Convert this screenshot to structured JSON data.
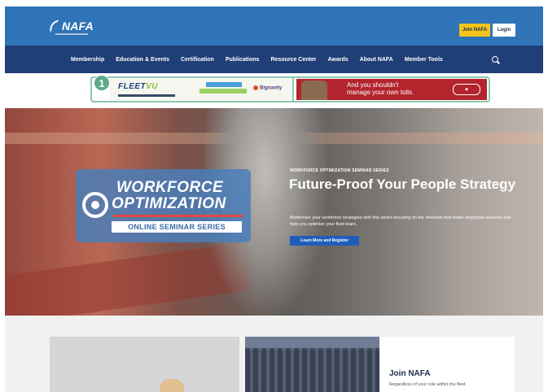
{
  "header": {
    "logo_text": "NAFA",
    "join_label": "Join NAFA",
    "login_label": "Login"
  },
  "nav": {
    "items": [
      {
        "label": "Membership"
      },
      {
        "label": "Education & Events"
      },
      {
        "label": "Certification"
      },
      {
        "label": "Publications"
      },
      {
        "label": "Resource Center"
      },
      {
        "label": "Awards"
      },
      {
        "label": "About NAFA"
      },
      {
        "label": "Member Tools"
      }
    ]
  },
  "ads": {
    "badge_number": "1",
    "ad1": {
      "logo_prefix": "FLEET",
      "logo_suffix": "VU",
      "brand": "Bignanity"
    },
    "ad2": {
      "text_line1": "And you shouldn't",
      "text_line2": "manage your own tolls."
    }
  },
  "hero": {
    "seminar_title_line1": "WORKFORCE",
    "seminar_title_line2": "OPTIMIZATION",
    "seminar_subtitle": "ONLINE SEMINAR SERIES",
    "eyebrow": "WORKFORCE OPTIMIZATION SEMINAR SERIES",
    "headline": "Future-Proof Your People Strategy",
    "body": "Modernize your workforce strategies with this series focusing on the methods that foster employee success and help you optimize your fleet team.",
    "cta_label": "Learn More and Register"
  },
  "below": {
    "join_title": "Join NAFA",
    "join_text": "Regardless of your role within the fleet"
  },
  "colors": {
    "header_blue": "#2f74b7",
    "nav_navy": "#1f3f76",
    "join_yellow": "#f2c41d",
    "badge_green": "#5aa98a",
    "cta_blue": "#1f5dbb",
    "ad_red": "#b3242c"
  }
}
